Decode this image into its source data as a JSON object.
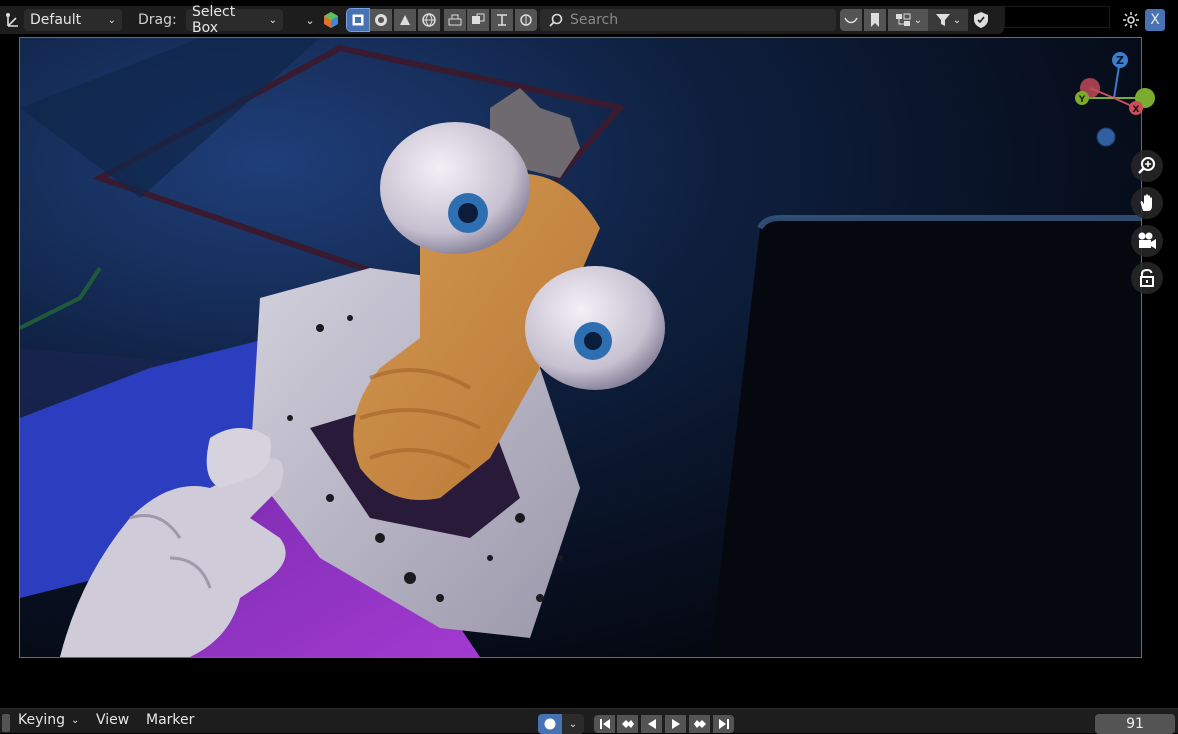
{
  "header": {
    "orientation_value": "Default",
    "drag_label": "Drag:",
    "drag_value": "Select Box",
    "search_placeholder": "Search",
    "x_button": "X"
  },
  "viewport": {
    "gizmo_axes": [
      "Z",
      "Y",
      "X"
    ],
    "nav_tools": [
      "zoom-icon",
      "hand-pan-icon",
      "camera-icon",
      "lock-icon"
    ]
  },
  "timeline": {
    "keying_label": "Keying",
    "view_label": "View",
    "marker_label": "Marker",
    "current_frame": "91"
  },
  "colors": {
    "active_blue": "#4772b3",
    "axis_x": "#c84e5a",
    "axis_y": "#7cac2e",
    "axis_z": "#3e7ccd"
  }
}
